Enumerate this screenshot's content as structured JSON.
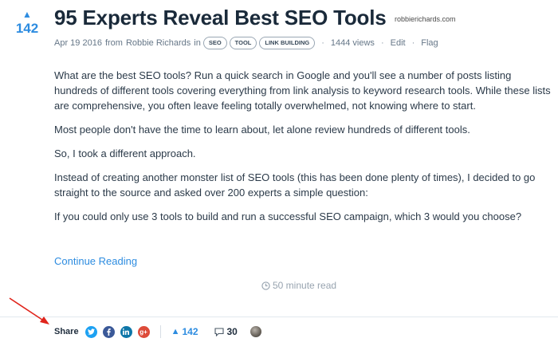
{
  "post": {
    "vote_count": "142",
    "title": "95 Experts Reveal Best SEO Tools",
    "domain": "robbierichards.com",
    "meta": {
      "date": "Apr 19 2016",
      "from_word": "from",
      "author": "Robbie Richards",
      "in_word": "in",
      "tags": [
        "SEO",
        "TOOL",
        "LINK BUILDING"
      ],
      "views": "1444 views",
      "edit": "Edit",
      "flag": "Flag"
    },
    "paragraphs": [
      "What are the best SEO tools? Run a quick search in Google and you'll see a number of posts listing hundreds of different tools covering everything from link analysis to keyword research tools. While these lists are comprehensive, you often leave feeling totally overwhelmed, not knowing where to start.",
      "Most people don't have the time to learn about, let alone review hundreds of different tools.",
      "So, I took a different approach.",
      "Instead of creating another monster list of SEO tools (this has been done plenty of times), I decided to go straight to the source and asked over 200 experts a simple question:",
      "If you could only use 3 tools to build and run a successful SEO campaign, which 3 would you choose?"
    ],
    "continue_label": "Continue Reading",
    "read_time": "50 minute read"
  },
  "share_bar": {
    "label": "Share",
    "social_icons": [
      "twitter-icon",
      "facebook-icon",
      "linkedin-icon",
      "google-plus-icon"
    ],
    "votes": "142",
    "comments": "30"
  },
  "colors": {
    "accent": "#2d8ce0",
    "annotation_arrow": "#e0241b",
    "twitter": "#1da1f2",
    "facebook": "#3b5998",
    "linkedin": "#0e76a8",
    "google_plus": "#dd4b39"
  }
}
